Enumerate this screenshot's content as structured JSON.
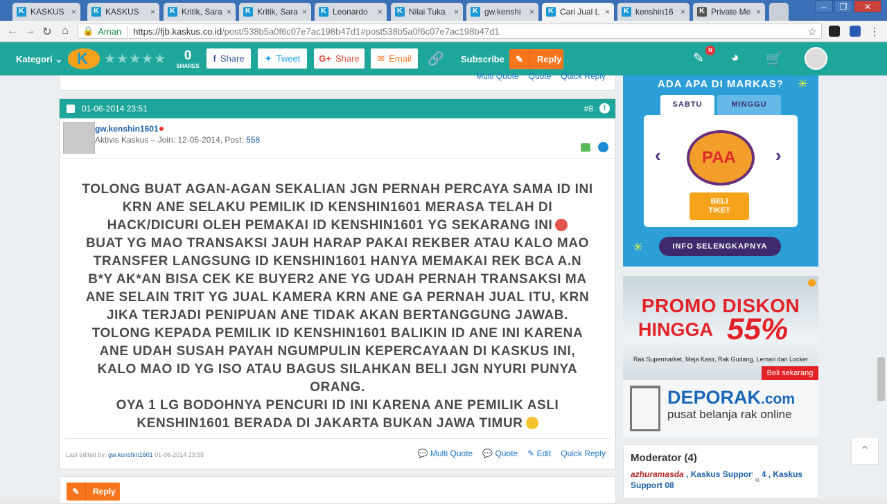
{
  "browser": {
    "tabs": [
      {
        "label": "KASKUS -"
      },
      {
        "label": "KASKUS"
      },
      {
        "label": "Kritik, Sara"
      },
      {
        "label": "Kritik, Sara"
      },
      {
        "label": "Leonardo"
      },
      {
        "label": "Nilai Tuka"
      },
      {
        "label": "gw.kenshi"
      },
      {
        "label": "Cari Jual L"
      },
      {
        "label": "kenshin16"
      },
      {
        "label": "Private Me"
      }
    ],
    "security_label": "Aman",
    "url_host": "https://fjb.kaskus.co.id",
    "url_path": "/post/538b5a0f6c07e7ac198b47d1#post538b5a0f6c07e7ac198b47d1"
  },
  "toolbar": {
    "kategori": "Kategori",
    "rating_stars": "★★★★★",
    "shares_count": "0",
    "shares_label": "SHARES",
    "share_fb": "Share",
    "tweet": "Tweet",
    "share_gplus": "Share",
    "email": "Email",
    "subscribe": "Subscribe",
    "reply": "Reply",
    "notif_badge": "N"
  },
  "prev_post_actions": {
    "multi_quote": "Multi Quote",
    "quote": "Quote",
    "quick_reply": "Quick Reply"
  },
  "post": {
    "datetime": "01-06-2014 23:51",
    "number": "#8",
    "username": "gw.kenshin1601",
    "user_info_prefix": "Aktivis Kaskus – Join: 12-05-2014, Post: ",
    "post_count": "558",
    "content_lines": [
      "TOLONG BUAT AGAN-AGAN SEKALIAN JGN PERNAH PERCAYA SAMA ID INI",
      "KRN ANE SELAKU PEMILIK ID KENSHIN1601 MERASA TELAH DI",
      "HACK/DICURI OLEH PEMAKAI ID KENSHIN1601 YG SEKARANG INI",
      "BUAT YG MAO TRANSAKSI JAUH HARAP PAKAI REKBER ATAU KALO MAO",
      "TRANSFER LANGSUNG ID KENSHIN1601 HANYA MEMAKAI REK BCA A.N",
      "B*Y AK*AN BISA CEK KE BUYER2 ANE YG UDAH PERNAH TRANSAKSI MA",
      "ANE SELAIN TRIT YG JUAL KAMERA KRN ANE GA PERNAH JUAL ITU, KRN",
      "JIKA TERJADI PENIPUAN ANE TIDAK AKAN BERTANGGUNG JAWAB.",
      "TOLONG KEPADA PEMILIK ID KENSHIN1601 BALIKIN ID ANE INI KARENA",
      "ANE UDAH SUSAH PAYAH NGUMPULIN KEPERCAYAAN DI KASKUS INI,",
      "KALO MAO ID YG ISO ATAU BAGUS SILAHKAN BELI JGN NYURI PUNYA",
      "ORANG.",
      "OYA 1 LG BODOHNYA PENCURI ID INI KARENA ANE PEMILIK ASLI",
      "KENSHIN1601 BERADA DI JAKARTA BUKAN JAWA TIMUR"
    ],
    "last_edited_prefix": "Last edited by: ",
    "last_edited_user": "gw.kenshin1601",
    "last_edited_time": " 01-06-2014 23:55",
    "actions": {
      "multi_quote": "Multi Quote",
      "quote": "Quote",
      "edit": "Edit",
      "quick_reply": "Quick Reply"
    }
  },
  "bottom_reply": "Reply",
  "sidebar": {
    "markas": {
      "title": "ADA APA DI MARKAS?",
      "tab_sabtu": "SABTU",
      "tab_minggu": "MINGGU",
      "beli_tiket_1": "BELI",
      "beli_tiket_2": "TIKET",
      "info": "INFO SELENGKAPNYA"
    },
    "ad": {
      "line1": "PROMO DISKON",
      "line2": "HINGGA",
      "percent": "55%",
      "sub": "Rak Supermarket, Meja Kasir, Rak Gudang, Lemari dan Locker",
      "cta": "Beli sekarang",
      "brand": "DEPORAK",
      "brand_tld": ".com",
      "tagline": "pusat belanja rak online"
    },
    "moderator": {
      "heading": "Moderator (4)",
      "m1": "azhuramasda",
      "rest": " , Kaskus Support 04 , Kaskus Support 08"
    }
  }
}
